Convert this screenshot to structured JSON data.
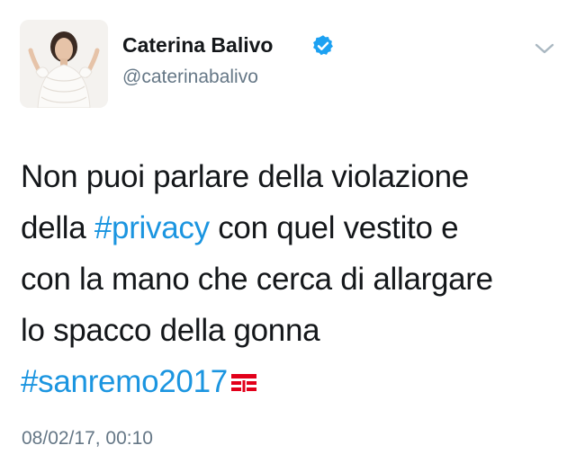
{
  "tweet": {
    "author": {
      "display_name": "Caterina Balivo",
      "username": "@caterinabalivo",
      "verified": true,
      "avatar_icon": "profile-photo-icon"
    },
    "text_lines": [
      [
        {
          "text": "Non puoi parlare della violazione"
        }
      ],
      [
        {
          "text": "della "
        },
        {
          "hashtag": "#privacy"
        },
        {
          "text": " con quel vestito e"
        }
      ],
      [
        {
          "text": "con la mano che cerca di allargare"
        }
      ],
      [
        {
          "text": "lo spacco della gonna"
        }
      ],
      [
        {
          "hashtag": "#sanremo2017"
        }
      ]
    ],
    "line1": "Non puoi parlare della violazione",
    "line2_pre": "della ",
    "line2_hashtag": "#privacy",
    "line2_post": " con quel vestito e",
    "line3": "con la mano che cerca di allargare",
    "line4": "lo spacco della gonna",
    "line5_hashtag": "#sanremo2017",
    "hashtag_emoji_icon": "tim-logo-icon",
    "timestamp": "08/02/17, 00:10",
    "menu_icon": "chevron-down-icon"
  },
  "colors": {
    "text": "#14171a",
    "secondary": "#657786",
    "link": "#1b95e0",
    "verified_badge": "#1da1f2",
    "tim_red": "#e2001a"
  }
}
